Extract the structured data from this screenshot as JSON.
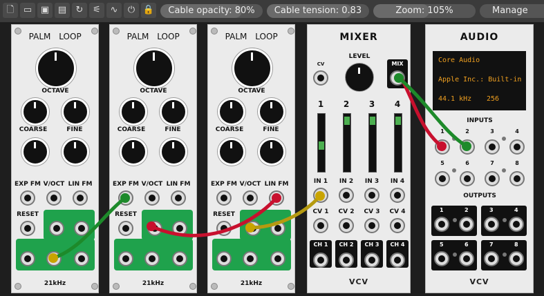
{
  "toolbar": {
    "buttons": [
      "new-icon",
      "open-icon",
      "save-icon",
      "save-as-icon",
      "revert-icon",
      "disconnect-icon",
      "cpu-icon",
      "power-icon",
      "lock-icon"
    ],
    "cable_opacity": {
      "label": "Cable opacity: 80%",
      "value": 0.8
    },
    "cable_tension": {
      "label": "Cable tension: 0.83",
      "value": 0.83
    },
    "zoom": {
      "label": "Zoom: 105%",
      "value": 0.55
    },
    "manage": "Manage plugins"
  },
  "vco": {
    "title_left": "PALM",
    "title_right": "LOOP",
    "octave": "OCTAVE",
    "coarse": "COARSE",
    "fine": "FINE",
    "exp_fm": "EXP FM",
    "voct": "V/OCT",
    "lin_fm": "LIN FM",
    "reset": "RESET",
    "freq": "21kHz"
  },
  "mixer": {
    "title": "MIXER",
    "level": "LEVEL",
    "cv": "CV",
    "mix": "MIX",
    "channels": [
      "1",
      "2",
      "3",
      "4"
    ],
    "inputs": [
      "IN 1",
      "IN 2",
      "IN 3",
      "IN 4"
    ],
    "cvs": [
      "CV 1",
      "CV 2",
      "CV 3",
      "CV 4"
    ],
    "outs": [
      "CH 1",
      "CH 2",
      "CH 3",
      "CH 4"
    ],
    "logo": "VCV"
  },
  "audio": {
    "title": "AUDIO",
    "driver": "Core Audio",
    "device": "Apple Inc.: Built-in",
    "rate": "44.1 kHz",
    "block": "256",
    "inputs_label": "INPUTS",
    "outputs_label": "OUTPUTS",
    "in_nums": [
      "1",
      "2",
      "3",
      "4",
      "5",
      "6",
      "7",
      "8"
    ],
    "out_nums": [
      "1",
      "2",
      "3",
      "4",
      "5",
      "6",
      "7",
      "8"
    ],
    "logo": "VCV"
  },
  "colors": {
    "cable_green": "#1d8a2a",
    "cable_red": "#c8102e",
    "cable_yellow": "#c9a400",
    "panel_green": "#1fa24c"
  }
}
